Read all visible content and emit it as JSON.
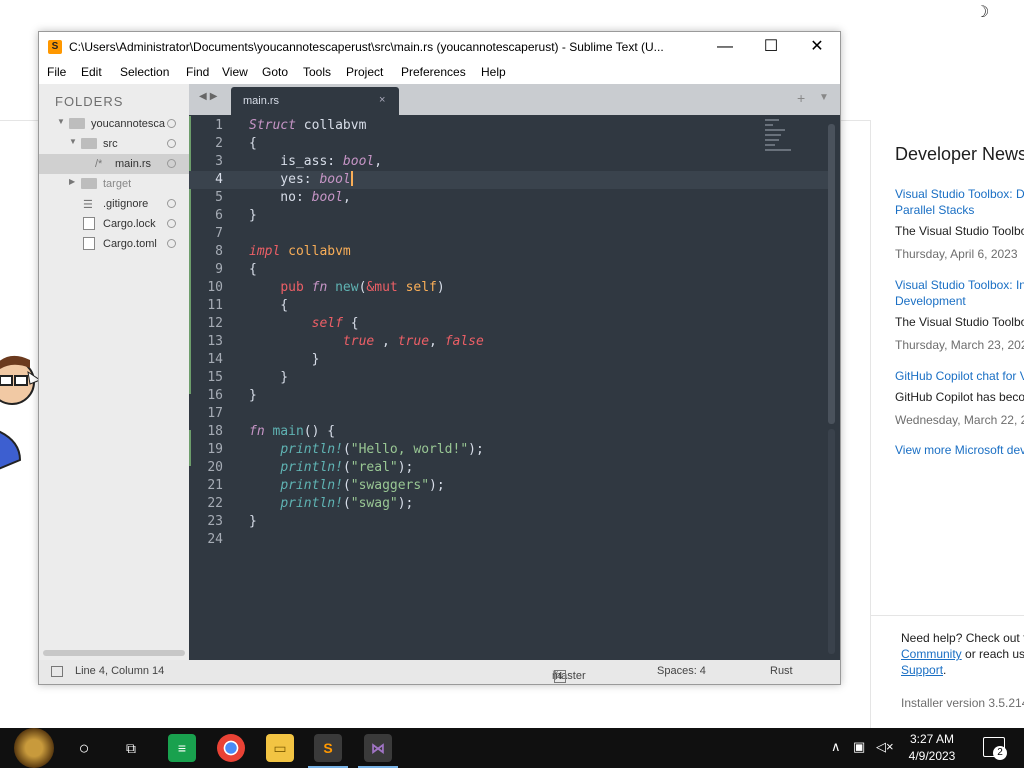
{
  "installer": {
    "news_title": "Developer News",
    "news": [
      {
        "link": "Visual Studio Toolbox: De",
        "link2": "Parallel Stacks",
        "desc": "The Visual Studio Toolbo",
        "date": "Thursday, April 6, 2023"
      },
      {
        "link": "Visual Studio Toolbox: In",
        "link2": "Development",
        "desc": "The Visual Studio Toolbo",
        "date": "Thursday, March 23, 202"
      },
      {
        "link": "GitHub Copilot chat for V",
        "link2": "",
        "desc": "GitHub Copilot has beco",
        "date": "Wednesday, March 22, 2"
      }
    ],
    "more_link": "View more Microsoft dev",
    "help_line1": "Need help? Check out t",
    "help_community": "Community",
    "help_mid": " or reach us",
    "help_support": "Support",
    "help_end": ".",
    "installer_version": "Installer version 3.5.214"
  },
  "window": {
    "title": "C:\\Users\\Administrator\\Documents\\youcannotescaperust\\src\\main.rs (youcannotescaperust) - Sublime Text (U...",
    "app_icon": "S",
    "minimize": "—",
    "maximize": "☐",
    "close": "✕"
  },
  "menu": [
    "File",
    "Edit",
    "Selection",
    "Find",
    "View",
    "Goto",
    "Tools",
    "Project",
    "Preferences",
    "Help"
  ],
  "sidebar": {
    "header": "FOLDERS",
    "items": [
      {
        "label": "youcannotesca",
        "type": "folder",
        "open": true
      },
      {
        "label": "src",
        "type": "folder",
        "open": true
      },
      {
        "label": "main.rs",
        "type": "file-rs",
        "selected": true
      },
      {
        "label": "target",
        "type": "folder",
        "open": false
      },
      {
        "label": ".gitignore",
        "type": "file-list"
      },
      {
        "label": "Cargo.lock",
        "type": "file"
      },
      {
        "label": "Cargo.toml",
        "type": "file"
      }
    ]
  },
  "tab": {
    "label": "main.rs",
    "close": "×",
    "nav": "◀▶",
    "plus": "+",
    "dropdown": "▼"
  },
  "code": {
    "current_line": 4,
    "line_numbers": [
      "1",
      "2",
      "3",
      "4",
      "5",
      "6",
      "7",
      "8",
      "9",
      "10",
      "11",
      "12",
      "13",
      "14",
      "15",
      "16",
      "17",
      "18",
      "19",
      "20",
      "21",
      "22",
      "23",
      "24"
    ]
  },
  "status": {
    "position": "Line 4, Column 14",
    "branch": "master",
    "branch_count": "4",
    "spaces": "Spaces: 4",
    "syntax": "Rust"
  },
  "taskbar": {
    "time": "3:27 AM",
    "date": "4/9/2023",
    "notification_count": "2"
  },
  "colors": {
    "editor_bg": "#303841",
    "keyword": "#ec5f66",
    "function": "#5fb3b3",
    "string": "#99c794",
    "type": "#c695c6",
    "name": "#f9ae58",
    "caret": "#f9ae58"
  }
}
